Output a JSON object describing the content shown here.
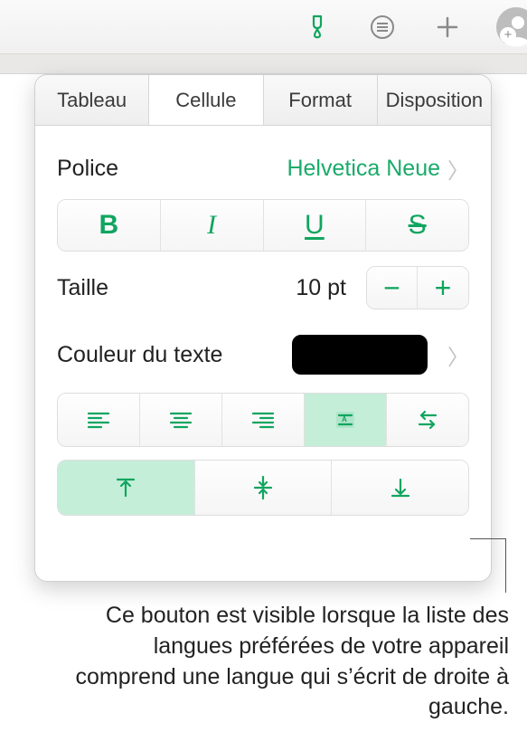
{
  "toolbar": {
    "icons": [
      "format-brush-icon",
      "list-icon",
      "add-icon",
      "share-avatar-icon"
    ]
  },
  "tabs": {
    "items": [
      "Tableau",
      "Cellule",
      "Format",
      "Disposition"
    ],
    "active_index": 1
  },
  "font": {
    "label": "Police",
    "value": "Helvetica Neue"
  },
  "style_buttons": {
    "bold": "B",
    "italic": "I",
    "underline": "U",
    "strike": "S"
  },
  "size": {
    "label": "Taille",
    "value": "10 pt"
  },
  "text_color": {
    "label": "Couleur du texte",
    "swatch_hex": "#000000"
  },
  "h_align": {
    "options": [
      "align-left",
      "align-center",
      "align-right",
      "align-justify",
      "direction-rtl"
    ],
    "selected_index": 3
  },
  "v_align": {
    "options": [
      "align-top",
      "align-middle",
      "align-bottom"
    ],
    "selected_index": 0
  },
  "caption": "Ce bouton est visible lorsque la liste des langues préférées de votre appareil comprend une langue qui s’écrit de droite à gauche."
}
